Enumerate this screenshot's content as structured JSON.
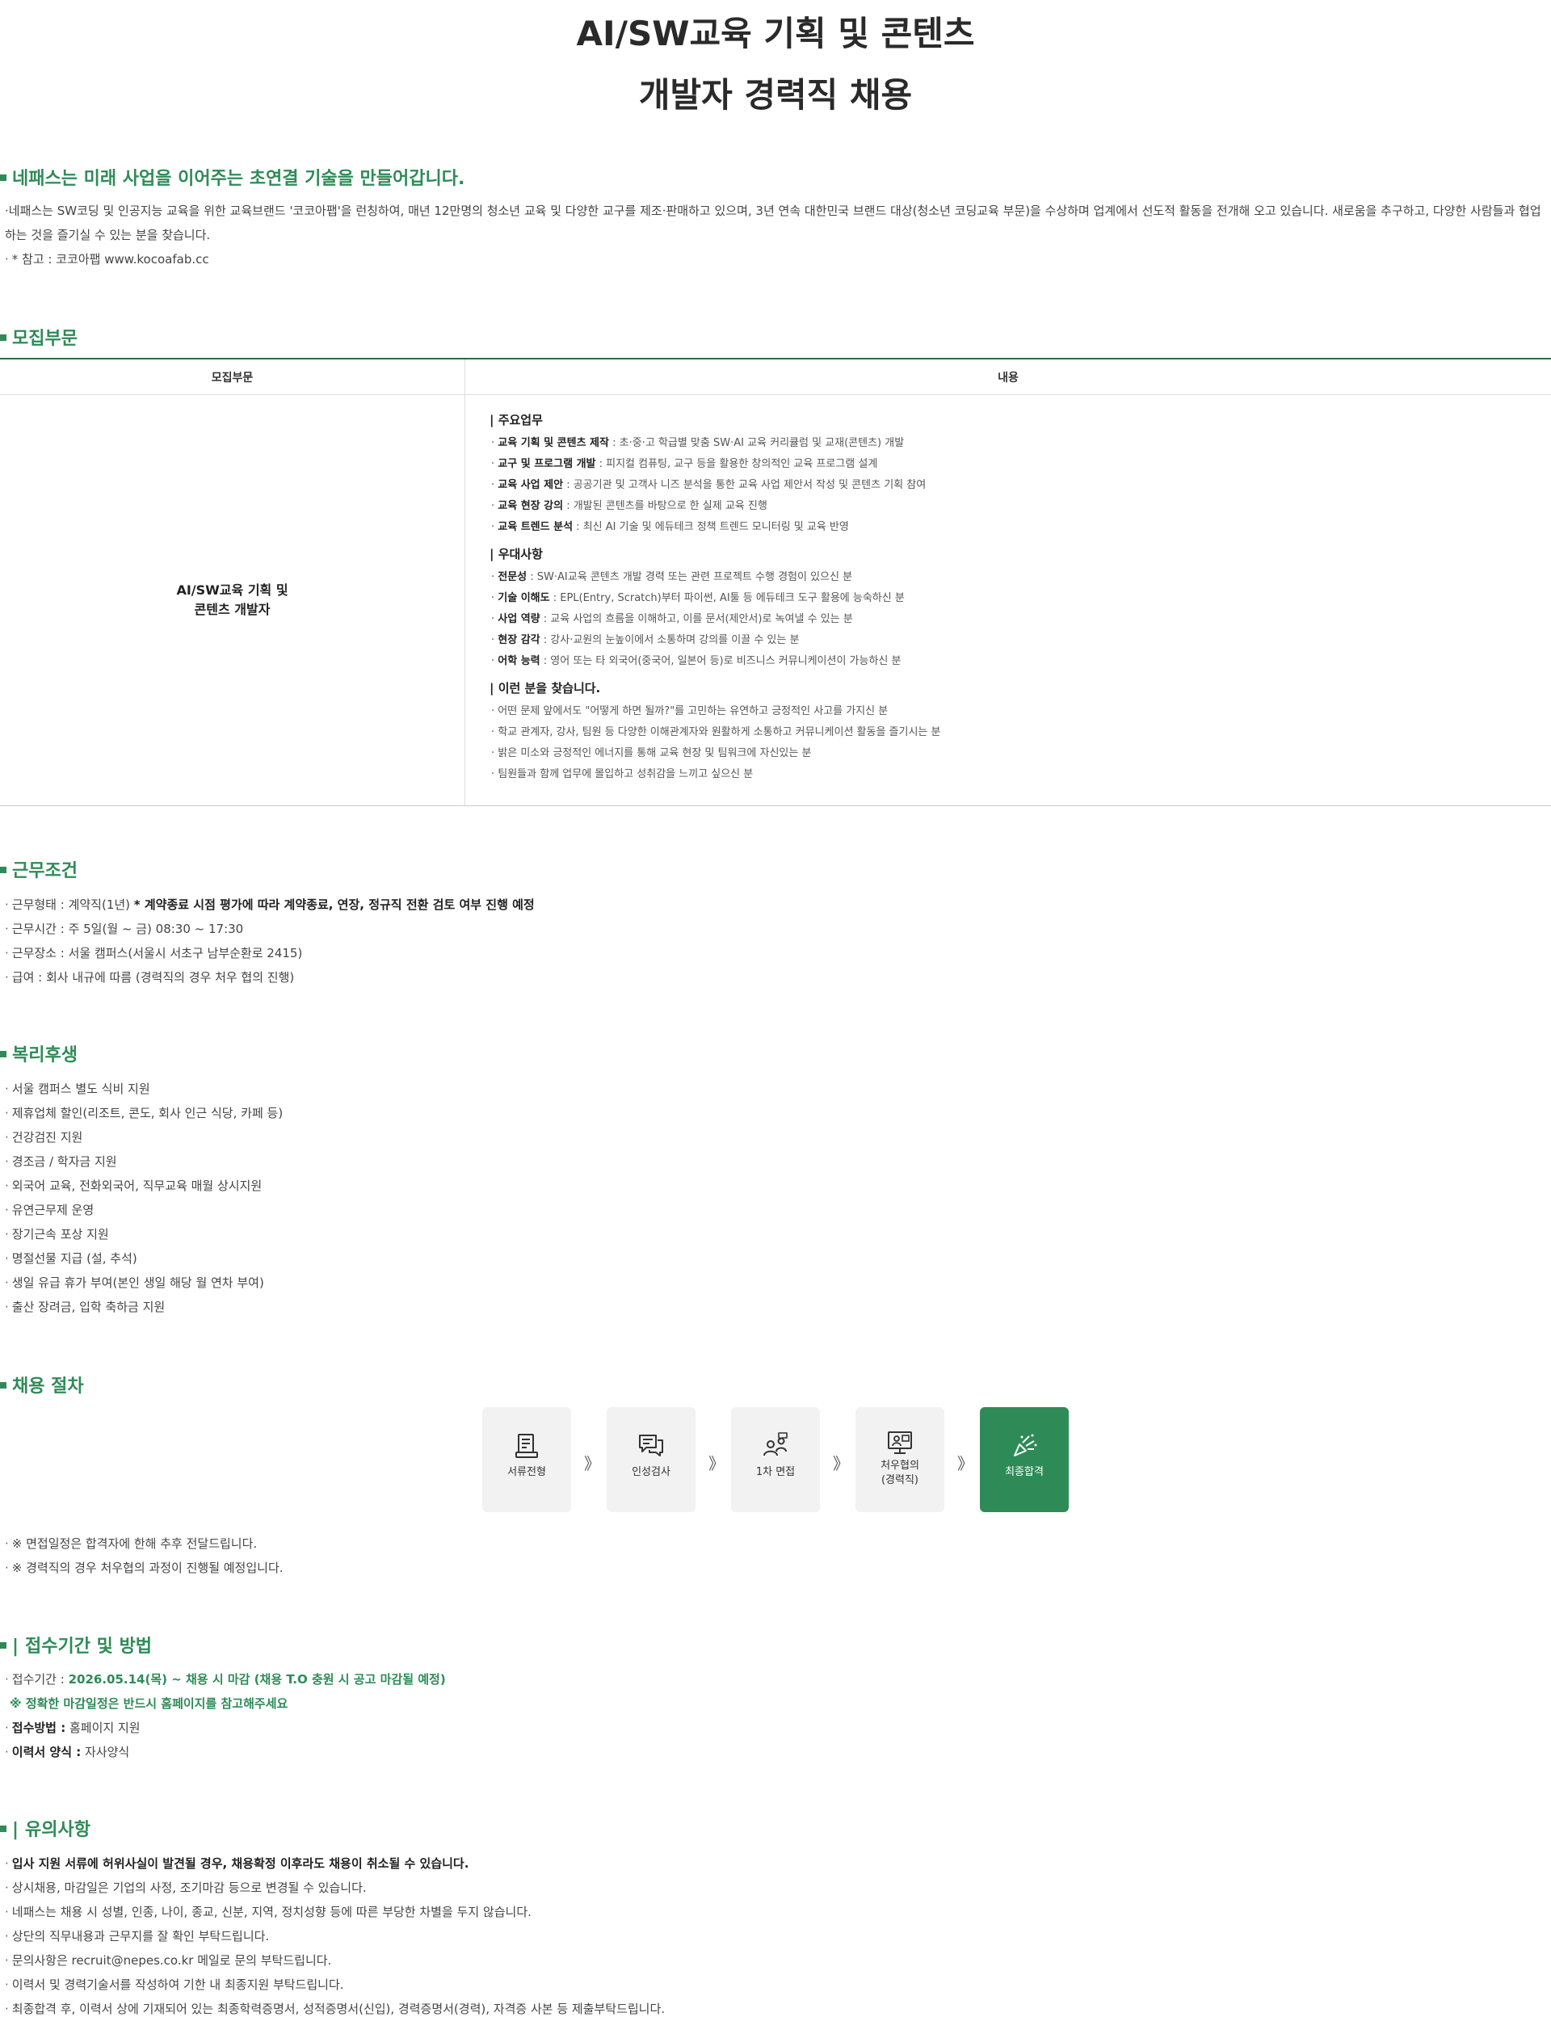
{
  "title": {
    "line1": "AI/SW교육 기획 및 콘텐츠",
    "line2": "개발자 경력직 채용"
  },
  "intro": {
    "heading": "네패스는 미래 사업을 이어주는 초연결 기술을 만들어갑니다.",
    "paragraph": "네패스는 SW코딩 및 인공지능 교육을 위한 교육브랜드 '코코아팹'을 런칭하여, 매년 12만명의 청소년 교육 및 다양한 교구를 제조·판매하고 있으며, 3년 연속 대한민국 브랜드 대상(청소년 코딩교육 부문)을 수상하며 업계에서 선도적 활동을 전개해 오고 있습니다. 새로움을 추구하고, 다양한 사람들과 협업하는 것을 즐기실 수 있는 분을 찾습니다.",
    "note": "* 참고 : 코코아팹 www.kocoafab.cc"
  },
  "recruit": {
    "heading": "모집부문",
    "col1": "모집부문",
    "col2": "내용",
    "position_line1": "AI/SW교육 기획 및",
    "position_line2": "콘텐츠 개발자",
    "groups": [
      {
        "title": "주요업무",
        "items": [
          {
            "label": "교육 기획 및 콘텐츠 제작",
            "text": " : 초·중·고 학급별 맞춤 SW·AI 교육 커리큘럼 및 교재(콘텐츠) 개발"
          },
          {
            "label": "교구 및 프로그램 개발",
            "text": " : 피지컬 컴퓨팅, 교구 등을 활용한 창의적인 교육 프로그램 설계"
          },
          {
            "label": "교육 사업 제안",
            "text": " : 공공기관 및 고객사 니즈 분석을 통한 교육 사업 제안서 작성 및 콘텐츠 기획 참여"
          },
          {
            "label": "교육 현장 강의",
            "text": " : 개발된 콘텐츠를 바탕으로 한 실제 교육 진행"
          },
          {
            "label": "교육 트렌드 분석",
            "text": " : 최신 AI 기술 및 에듀테크 정책 트렌드 모니터링 및 교육 반영"
          }
        ]
      },
      {
        "title": "우대사항",
        "items": [
          {
            "label": "전문성",
            "text": " : SW·AI교육 콘텐츠 개발 경력 또는 관련 프로젝트 수행 경험이 있으신 분"
          },
          {
            "label": "기술 이해도",
            "text": " : EPL(Entry, Scratch)부터 파이썬, AI툴 등 에듀테크 도구 활용에 능숙하신 분"
          },
          {
            "label": "사업 역량",
            "text": " : 교육 사업의 흐름을 이해하고, 이를 문서(제안서)로 녹여낼 수 있는 분"
          },
          {
            "label": "현장 감각",
            "text": " : 강사·교원의 눈높이에서 소통하며 강의를 이끌 수 있는 분"
          },
          {
            "label": "어학 능력",
            "text": " : 영어 또는 타 외국어(중국어, 일본어 등)로 비즈니스 커뮤니케이션이 가능하신 분"
          }
        ]
      },
      {
        "title": "이런 분을 찾습니다.",
        "items": [
          {
            "label": "",
            "text": "어떤 문제 앞에서도 \"어떻게 하면 될까?\"를 고민하는 유연하고 긍정적인 사고를 가지신 분"
          },
          {
            "label": "",
            "text": "학교 관계자, 강사, 팀원 등 다양한 이해관계자와 원활하게 소통하고 커뮤니케이션 활동을 즐기시는 분"
          },
          {
            "label": "",
            "text": "밝은 미소와 긍정적인 에너지를 통해 교육 현장 및 팀워크에 자신있는 분"
          },
          {
            "label": "",
            "text": "팀원들과 함께 업무에 몰입하고 성취감을 느끼고 싶으신 분"
          }
        ]
      }
    ]
  },
  "conditions": {
    "heading": "근무조건",
    "type_label": "근무형태 : 계약직(1년) ",
    "type_bold": "* 계약종료 시점 평가에 따라 계약종료, 연장, 정규직 전환 검토 여부 진행 예정",
    "hours": "근무시간 : 주 5일(월 ~ 금) 08:30 ~ 17:30",
    "place": "근무장소 : 서울 캠퍼스(서울시 서초구 남부순환로 2415)",
    "salary": "급여 : 회사 내규에 따름 (경력직의 경우 처우 협의 진행)"
  },
  "welfare": {
    "heading": "복리후생",
    "items": [
      "서울 캠퍼스 별도 식비 지원",
      "제휴업체 할인(리조트, 콘도, 회사 인근 식당, 카페 등)",
      "건강검진 지원",
      "경조금 / 학자금 지원",
      "외국어 교육, 전화외국어, 직무교육 매월 상시지원",
      "유연근무제 운영",
      "장기근속 포상 지원",
      "명절선물 지급 (설, 추석)",
      "생일 유급 휴가 부여(본인 생일 해당 월 연차 부여)",
      "출산 장려금, 입학 축하금 지원"
    ]
  },
  "process": {
    "heading": "채용 절차",
    "arrow": "》",
    "steps": [
      {
        "label": "서류전형",
        "icon": "document-icon"
      },
      {
        "label": "인성검사",
        "icon": "chat-icon"
      },
      {
        "label": "1차 면접",
        "icon": "interview-icon"
      },
      {
        "label": "처우협의\n(경력직)",
        "icon": "negotiation-icon"
      },
      {
        "label": "최종합격",
        "icon": "celebration-icon"
      }
    ],
    "notes": [
      "※ 면접일정은 합격자에 한해 추후 전달드립니다.",
      "※ 경력직의 경우 처우협의 과정이 진행될 예정입니다."
    ]
  },
  "apply": {
    "heading": "접수기간 및 방법",
    "heading_bar": "|",
    "period_label": "접수기간 : ",
    "period_value": "2026.05.14(목) ~ 채용 시 마감 (채용 T.O 충원 시 공고 마감될 예정)",
    "period_note": "※ 정확한 마감일정은 반드시 홈페이지를 참고해주세요",
    "method_label": "접수방법 :",
    "method_value": " 홈페이지 지원",
    "form_label": "이력서 양식 :",
    "form_value": " 자사양식"
  },
  "caution": {
    "heading": "유의사항",
    "heading_bar": "|",
    "bold_item": "입사 지원 서류에 허위사실이 발견될 경우, 채용확정 이후라도 채용이 취소될 수 있습니다.",
    "items": [
      "상시채용, 마감일은 기업의 사정, 조기마감 등으로 변경될 수 있습니다.",
      "네패스는 채용 시 성별, 인종, 나이, 종교, 신분, 지역, 정치성향 등에 따른 부당한 차별을 두지 않습니다.",
      "상단의 직무내용과 근무지를 잘 확인 부탁드립니다.",
      "문의사항은 recruit@nepes.co.kr 메일로 문의 부탁드립니다.",
      "이력서 및 경력기술서를 작성하여 기한 내 최종지원 부탁드립니다.",
      "최종합격 후, 이력서 상에 기재되어 있는 최종학력증명서, 성적증명서(신입), 경력증명서(경력), 자격증 사본 등 제출부탁드립니다."
    ]
  },
  "colors": {
    "accent": "#2e8b57",
    "table_border": "#2e6b3f"
  }
}
